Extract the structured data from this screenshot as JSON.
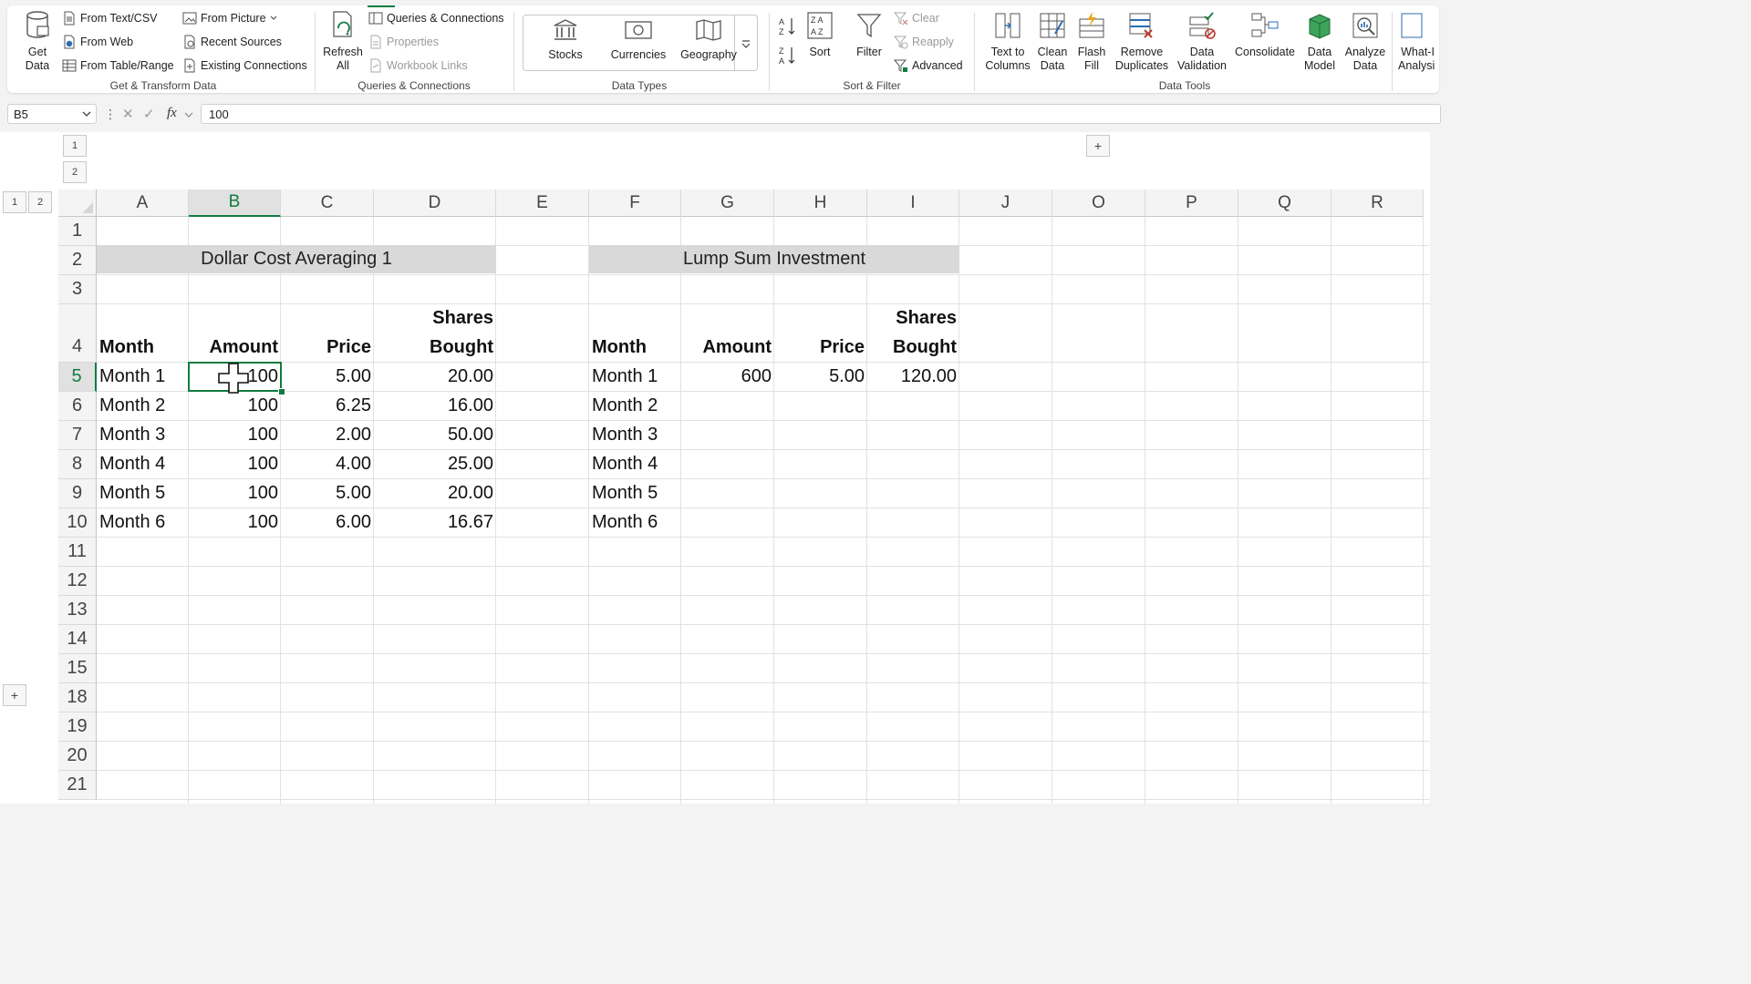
{
  "ribbon": {
    "get_transform": {
      "get_data": "Get\nData",
      "from_text_csv": "From Text/CSV",
      "from_web": "From Web",
      "from_table_range": "From Table/Range",
      "from_picture": "From Picture",
      "recent_sources": "Recent Sources",
      "existing_connections": "Existing Connections",
      "label": "Get & Transform Data"
    },
    "queries": {
      "refresh_all": "Refresh\nAll",
      "queries_connections": "Queries & Connections",
      "properties": "Properties",
      "workbook_links": "Workbook Links",
      "label": "Queries & Connections"
    },
    "data_types": {
      "stocks": "Stocks",
      "currencies": "Currencies",
      "geography": "Geography",
      "label": "Data Types"
    },
    "sort_filter": {
      "sort": "Sort",
      "filter": "Filter",
      "clear": "Clear",
      "reapply": "Reapply",
      "advanced": "Advanced",
      "label": "Sort & Filter"
    },
    "data_tools": {
      "text_to_columns": "Text to\nColumns",
      "clean_data": "Clean\nData",
      "flash_fill": "Flash\nFill",
      "remove_duplicates": "Remove\nDuplicates",
      "data_validation": "Data\nValidation",
      "consolidate": "Consolidate",
      "data_model": "Data\nModel",
      "analyze_data": "Analyze\nData",
      "what_if": "What-If\nAnalysis",
      "label": "Data Tools"
    }
  },
  "formula_bar": {
    "name_box": "B5",
    "formula": "100"
  },
  "outline": {
    "row_levels": [
      "1",
      "2"
    ],
    "col_levels": [
      "1",
      "2"
    ],
    "expand_symbol": "+"
  },
  "columns": [
    "A",
    "B",
    "C",
    "D",
    "E",
    "F",
    "G",
    "H",
    "I",
    "J",
    "O",
    "P",
    "Q",
    "R"
  ],
  "rows": [
    "1",
    "2",
    "3",
    "4",
    "5",
    "6",
    "7",
    "8",
    "9",
    "10",
    "11",
    "12",
    "13",
    "14",
    "15",
    "18",
    "19",
    "20",
    "21"
  ],
  "sheet": {
    "dca": {
      "title": "Dollar Cost Averaging 1",
      "headers": {
        "month": "Month",
        "amount": "Amount",
        "price": "Price",
        "shares_1": "Shares",
        "shares_2": "Bought"
      },
      "rows": [
        {
          "month": "Month 1",
          "amount": "100",
          "price": "5.00",
          "shares": "20.00"
        },
        {
          "month": "Month 2",
          "amount": "100",
          "price": "6.25",
          "shares": "16.00"
        },
        {
          "month": "Month 3",
          "amount": "100",
          "price": "2.00",
          "shares": "50.00"
        },
        {
          "month": "Month 4",
          "amount": "100",
          "price": "4.00",
          "shares": "25.00"
        },
        {
          "month": "Month 5",
          "amount": "100",
          "price": "5.00",
          "shares": "20.00"
        },
        {
          "month": "Month 6",
          "amount": "100",
          "price": "6.00",
          "shares": "16.67"
        }
      ]
    },
    "lump": {
      "title": "Lump Sum Investment",
      "headers": {
        "month": "Month",
        "amount": "Amount",
        "price": "Price",
        "shares_1": "Shares",
        "shares_2": "Bought"
      },
      "rows": [
        {
          "month": "Month 1",
          "amount": "600",
          "price": "5.00",
          "shares": "120.00"
        },
        {
          "month": "Month 2",
          "amount": "",
          "price": "",
          "shares": ""
        },
        {
          "month": "Month 3",
          "amount": "",
          "price": "",
          "shares": ""
        },
        {
          "month": "Month 4",
          "amount": "",
          "price": "",
          "shares": ""
        },
        {
          "month": "Month 5",
          "amount": "",
          "price": "",
          "shares": ""
        },
        {
          "month": "Month 6",
          "amount": "",
          "price": "",
          "shares": ""
        }
      ]
    }
  },
  "accent_color": "#107c41"
}
